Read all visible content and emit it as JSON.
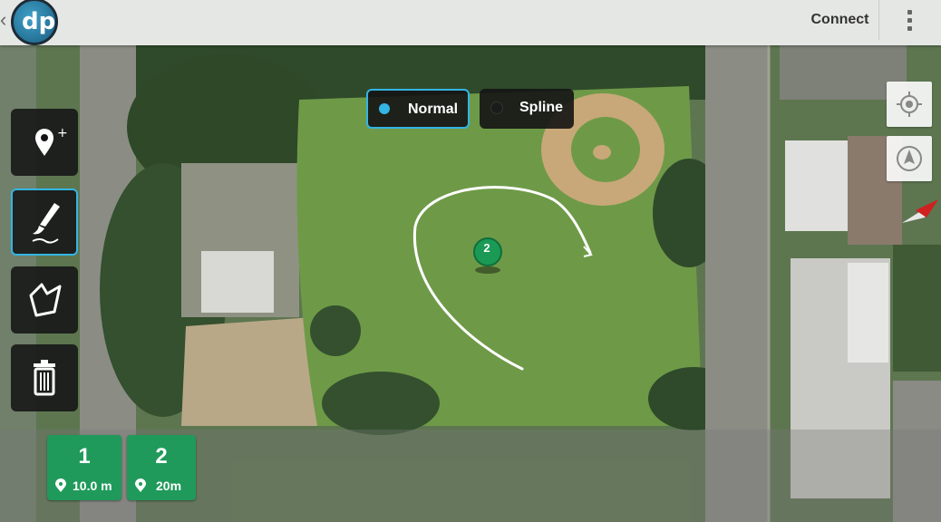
{
  "topbar": {
    "logo_text": "dp",
    "connect_label": "Connect"
  },
  "tools": [
    {
      "icon": "add-marker-icon"
    },
    {
      "icon": "draw-brush-icon",
      "active": true
    },
    {
      "icon": "polygon-icon"
    },
    {
      "icon": "trash-icon"
    }
  ],
  "mode": {
    "options": [
      "Normal",
      "Spline"
    ],
    "selected": "Normal"
  },
  "map_controls": [
    "my-location-icon",
    "compass-icon"
  ],
  "map": {
    "waypoint_marker_label": "2"
  },
  "waypoints": [
    {
      "number": "1",
      "altitude": "10.0 m"
    },
    {
      "number": "2",
      "altitude": "20m"
    }
  ],
  "colors": {
    "accent": "#33b5e5",
    "waypoint": "#1f9a5a",
    "toolbar_bg": "#141414"
  }
}
